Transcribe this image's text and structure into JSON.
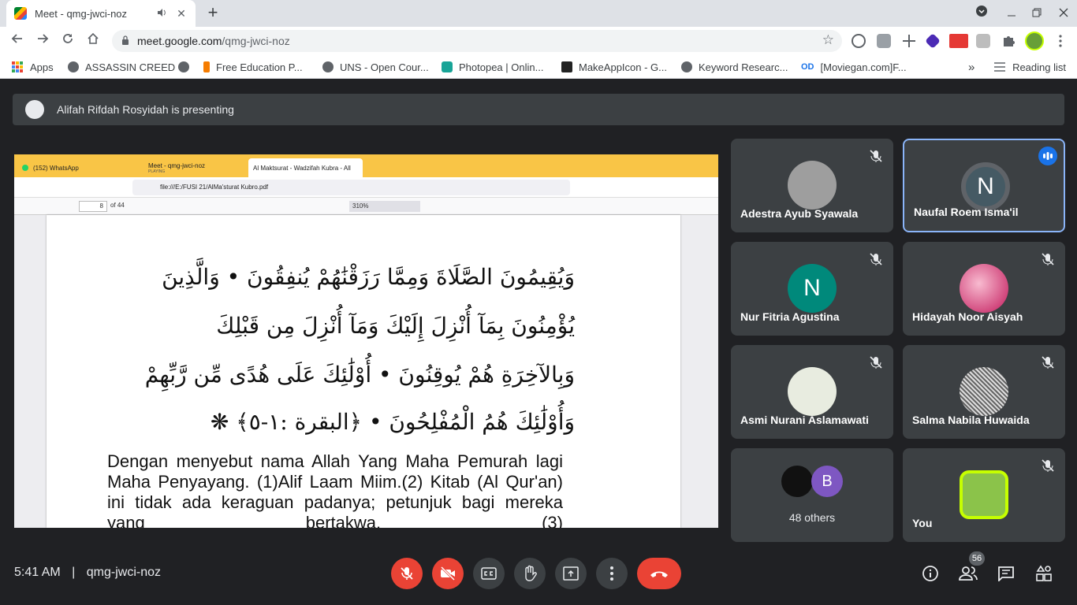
{
  "browser": {
    "tab_title": "Meet - qmg-jwci-noz",
    "tab_close": "✕",
    "new_tab": "+",
    "url_host": "meet.google.com",
    "url_path": "/qmg-jwci-noz"
  },
  "bookmarks": {
    "items": [
      {
        "label": "Apps"
      },
      {
        "label": "ASSASSIN CREED"
      },
      {
        "label": ""
      },
      {
        "label": "Free Education P..."
      },
      {
        "label": "UNS - Open Cour..."
      },
      {
        "label": "Photopea | Onlin..."
      },
      {
        "label": "MakeAppIcon - G..."
      },
      {
        "label": "Keyword Researc..."
      },
      {
        "label": "[Moviegan.com]F..."
      }
    ],
    "od_badge": "OD",
    "more": "»",
    "reading_list": "Reading list"
  },
  "presentation": {
    "banner": "Alifah Rifdah Rosyidah is presenting"
  },
  "shared_screen": {
    "tabs": [
      {
        "label": "(152) WhatsApp",
        "sub": ""
      },
      {
        "label": "Meet - qmg-jwci-noz",
        "sub": "PLAYING"
      },
      {
        "label": "Al Maktsurat - Wadzifah Kubra - All",
        "sub": ""
      }
    ],
    "url": "file:///E:/FUSI 21/AlMa'sturat Kubro.pdf",
    "page_current": "8",
    "page_total": "of 44",
    "zoom": "310%",
    "arabic_lines": [
      "وَيُقِيمُونَ الصَّلَاةَ وَمِمَّا رَزَقْنَٰهُمْ يُنفِقُونَ • وَالَّذِينَ",
      "يُؤْمِنُونَ بِمَآ أُنْزِلَ إِلَيْكَ وَمَآ أُنْزِلَ مِن قَبْلِكَ",
      "وَبِالآخِرَةِ هُمْ يُوقِنُونَ • أُوْلَٰئِكَ عَلَى هُدًى مِّن رَّبِّهِمْ",
      "وَأُوْلَٰئِكَ هُمُ الْمُفْلِحُونَ • ﴿البقرة :١-٥﴾ ❋"
    ],
    "latin_text": "Dengan menyebut nama Allah Yang Maha Pemurah lagi Maha Penyayang. (1)Alif Laam Miim.(2) Kitab (Al Qur'an) ini tidak ada keraguan padanya; petunjuk bagi mereka yang bertakwa. (3)"
  },
  "participants": [
    {
      "name": "Adestra Ayub Syawala",
      "initial": "",
      "color": "#9e9e9e",
      "muted": true,
      "talking": false
    },
    {
      "name": "Naufal Roem Isma'il",
      "initial": "N",
      "color": "#455a64",
      "muted": false,
      "talking": true
    },
    {
      "name": "Nur Fitria Agustina",
      "initial": "N",
      "color": "#00897b",
      "muted": true,
      "talking": false
    },
    {
      "name": "Hidayah Noor Aisyah",
      "initial": "",
      "color": "#d7a5b0",
      "muted": true,
      "talking": false
    },
    {
      "name": "Asmi Nurani Aslamawati",
      "initial": "",
      "color": "#e8ece0",
      "muted": true,
      "talking": false
    },
    {
      "name": "Salma Nabila Huwaida",
      "initial": "",
      "color": "#bdbdbd",
      "muted": true,
      "talking": false
    },
    {
      "name": "You",
      "initial": "",
      "color": "#8bc34a",
      "muted": true,
      "talking": false
    }
  ],
  "others": {
    "label": "48 others",
    "initial_b": "B"
  },
  "controls": {
    "time": "5:41 AM",
    "separator": "|",
    "meeting_code": "qmg-jwci-noz",
    "people_count": "56"
  }
}
